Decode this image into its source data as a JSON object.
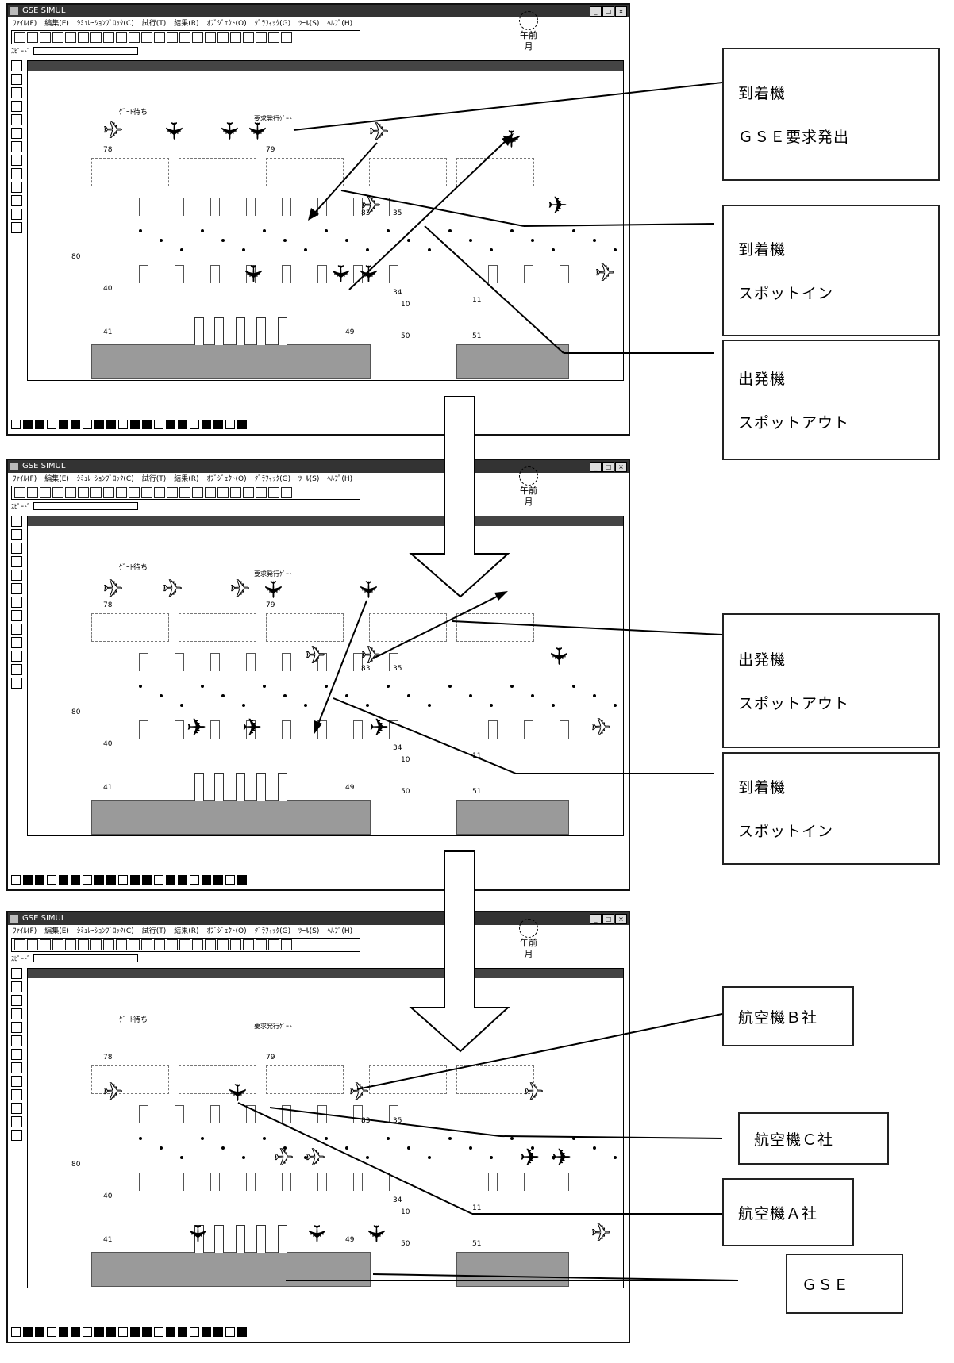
{
  "window": {
    "title": "GSE SIMUL",
    "buttons": [
      "_",
      "□",
      "×"
    ],
    "menu": [
      "ﾌｧｲﾙ(F)",
      "編集(E)",
      "ｼﾐｭﾚｰｼｮﾝﾌﾞﾛｯｸ(C)",
      "試行(T)",
      "結果(R)",
      "ｵﾌﾞｼﾞｪｸﾄ(O)",
      "ｸﾞﾗﾌｨｯｸ(G)",
      "ﾂｰﾙ(S)",
      "ﾍﾙﾌﾟ(H)"
    ],
    "speed_label": "ｽﾋﾟｰﾄﾞ",
    "clock_ampm": "午前",
    "clock_month": "月"
  },
  "scene": {
    "gate_wait": "ｹﾞｰﾄ待ち",
    "gse_request": "要求発行ｹﾞｰﾄ",
    "spot_labels": [
      "78",
      "79",
      "80",
      "40",
      "41",
      "49",
      "50",
      "51",
      "83",
      "35",
      "34",
      "10",
      "11"
    ]
  },
  "panels": [
    {
      "labels": [
        {
          "lines": [
            "到着機",
            "ＧＳＥ要求発出"
          ]
        },
        {
          "lines": [
            "到着機",
            "スポットイン"
          ]
        },
        {
          "lines": [
            "出発機",
            "スポットアウト"
          ]
        }
      ]
    },
    {
      "labels": [
        {
          "lines": [
            "出発機",
            "スポットアウト"
          ]
        },
        {
          "lines": [
            "到着機",
            "スポットイン"
          ]
        }
      ]
    },
    {
      "labels": [
        {
          "lines": [
            "航空機Ｂ社"
          ]
        },
        {
          "lines": [
            "航空機Ｃ社"
          ]
        },
        {
          "lines": [
            "航空機Ａ社"
          ]
        },
        {
          "lines": [
            "ＧＳＥ"
          ]
        }
      ]
    }
  ]
}
